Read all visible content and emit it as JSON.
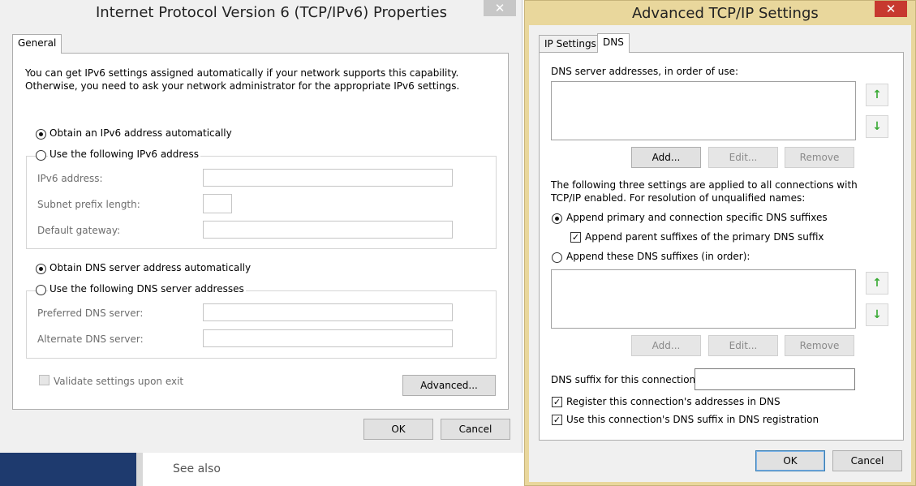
{
  "ipv6_dialog": {
    "title": "Internet Protocol Version 6 (TCP/IPv6) Properties",
    "close_label": "✕",
    "tab_general": "General",
    "intro_line1": "You can get IPv6 settings assigned automatically if your network supports this capability.",
    "intro_line2": "Otherwise, you need to ask your network administrator for the appropriate IPv6 settings.",
    "auto_ip_label": "Obtain an IPv6 address automatically",
    "manual_ip_label": "Use the following IPv6 address",
    "ipv6_address_label": "IPv6 address:",
    "subnet_prefix_label": "Subnet prefix length:",
    "default_gateway_label": "Default gateway:",
    "auto_dns_label": "Obtain DNS server address automatically",
    "manual_dns_label": "Use the following DNS server addresses",
    "preferred_dns_label": "Preferred DNS server:",
    "alternate_dns_label": "Alternate DNS server:",
    "validate_label": "Validate settings upon exit",
    "advanced_label": "Advanced...",
    "ok_label": "OK",
    "cancel_label": "Cancel",
    "values": {
      "ipv6_address": "",
      "subnet_prefix": "",
      "default_gateway": "",
      "preferred_dns": "",
      "alternate_dns": ""
    }
  },
  "advanced_dialog": {
    "title": "Advanced TCP/IP Settings",
    "close_label": "✕",
    "tab_ip_settings": "IP Settings",
    "tab_dns": "DNS",
    "dns_servers_label": "DNS server addresses, in order of use:",
    "add_label": "Add...",
    "edit_label": "Edit...",
    "remove_label": "Remove",
    "info_line1": "The following three settings are applied to all connections with",
    "info_line2": "TCP/IP enabled. For resolution of unqualified names:",
    "append_primary_label": "Append primary and connection specific DNS suffixes",
    "append_parent_label": "Append parent suffixes of the primary DNS suffix",
    "append_these_label": "Append these DNS suffixes (in order):",
    "suffix_connection_label": "DNS suffix for this connection:",
    "suffix_connection_value": "",
    "register_label": "Register this connection's addresses in DNS",
    "use_suffix_label": "Use this connection's DNS suffix in DNS registration",
    "ok_label": "OK",
    "cancel_label": "Cancel",
    "up_arrow": "↑",
    "down_arrow": "↓",
    "check_mark": "✓"
  },
  "background": {
    "see_also": "See also"
  },
  "colors": {
    "accent": "#3aaa35",
    "close_red": "#c7392f",
    "dialog_border": "#e9d79c",
    "desktop_blue": "#1e3a6e"
  }
}
